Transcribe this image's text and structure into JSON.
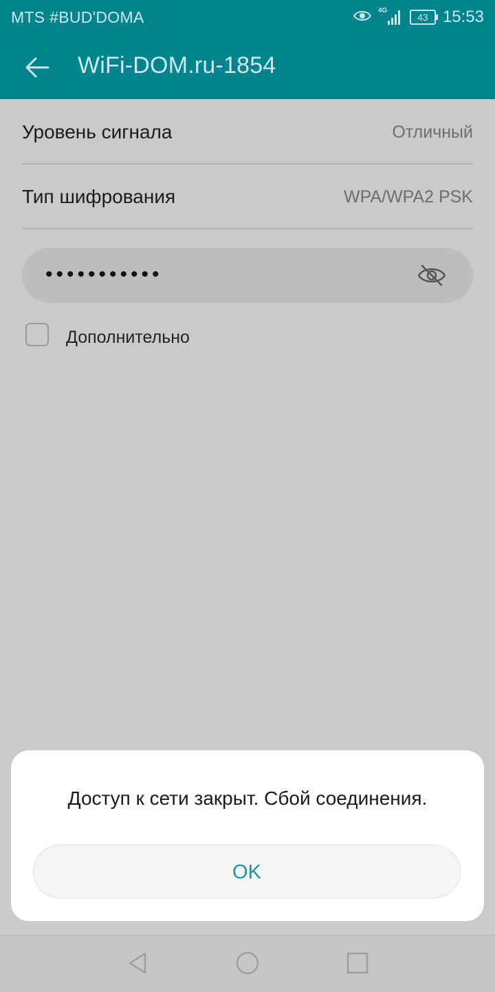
{
  "status_bar": {
    "carrier": "MTS #BUD'DOMA",
    "network": "4G",
    "battery": "43",
    "time": "15:53",
    "icons": [
      "eye-icon",
      "4g-icon",
      "signal-icon",
      "battery-icon"
    ]
  },
  "app_bar": {
    "title": "WiFi-DOM.ru-1854",
    "back_icon": "arrow-back-icon"
  },
  "details": [
    {
      "label": "Уровень сигнала",
      "value": "Отличный"
    },
    {
      "label": "Тип шифрования",
      "value": "WPA/WPA2 PSK"
    }
  ],
  "password": {
    "value": "•••••••••••",
    "toggle_icon": "eye-off-icon"
  },
  "advanced": {
    "label": "Дополнительно",
    "checked": false
  },
  "dialog": {
    "message": "Доступ к сети закрыт. Сбой соединения.",
    "ok_label": "OK"
  },
  "nav_bar": {
    "icons": [
      "nav-back-icon",
      "nav-home-icon",
      "nav-recents-icon"
    ]
  },
  "colors": {
    "accent": "#00858f",
    "button_text": "#1897a8",
    "scrim_background": "#cacaca"
  }
}
